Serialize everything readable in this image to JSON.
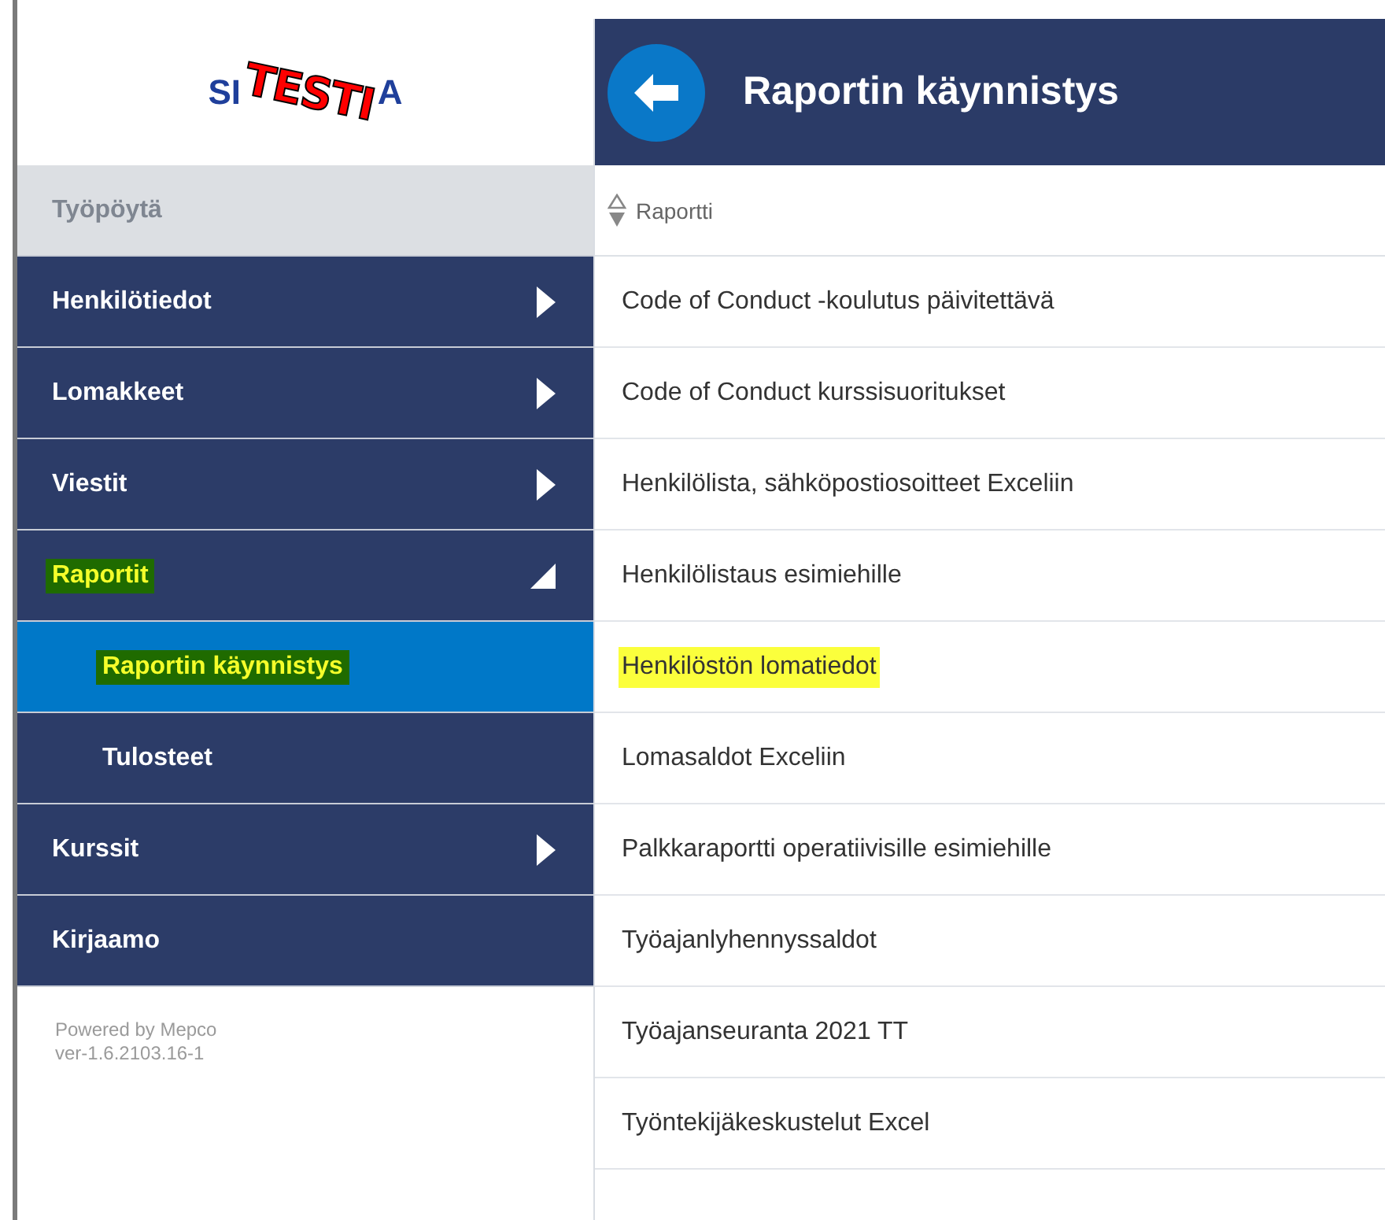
{
  "logo": {
    "brand_left": "SI",
    "brand_right": "A",
    "stamp": "TESTI"
  },
  "sidebar": {
    "items": [
      {
        "label": "Työpöytä",
        "kind": "disabled",
        "selected": false,
        "highlighted": false
      },
      {
        "label": "Henkilötiedot",
        "kind": "group",
        "expanded": false,
        "selected": false,
        "highlighted": false
      },
      {
        "label": "Lomakkeet",
        "kind": "group",
        "expanded": false,
        "selected": false,
        "highlighted": false
      },
      {
        "label": "Viestit",
        "kind": "group",
        "expanded": false,
        "selected": false,
        "highlighted": false
      },
      {
        "label": "Raportit",
        "kind": "group",
        "expanded": true,
        "selected": false,
        "highlighted": true,
        "children": [
          {
            "label": "Raportin käynnistys",
            "selected": true,
            "highlighted": true
          },
          {
            "label": "Tulosteet",
            "selected": false,
            "highlighted": false
          }
        ]
      },
      {
        "label": "Kurssit",
        "kind": "group",
        "expanded": false,
        "selected": false,
        "highlighted": false
      },
      {
        "label": "Kirjaamo",
        "kind": "link",
        "selected": false,
        "highlighted": false
      }
    ],
    "footer": [
      "Powered by Mepco",
      "ver-1.6.2103.16-1"
    ]
  },
  "header": {
    "title": "Raportin käynnistys"
  },
  "table": {
    "columns": [
      "Raportti"
    ],
    "rows": [
      {
        "cells": [
          "Code of Conduct -koulutus päivitettävä"
        ],
        "highlighted": false
      },
      {
        "cells": [
          "Code of Conduct kurssisuoritukset"
        ],
        "highlighted": false
      },
      {
        "cells": [
          "Henkilölista, sähköpostiosoitteet Exceliin"
        ],
        "highlighted": false
      },
      {
        "cells": [
          "Henkilölistaus esimiehille"
        ],
        "highlighted": false
      },
      {
        "cells": [
          "Henkilöstön lomatiedot"
        ],
        "highlighted": true
      },
      {
        "cells": [
          "Lomasaldot Exceliin"
        ],
        "highlighted": false
      },
      {
        "cells": [
          "Palkkaraportti operatiivisille esimiehille"
        ],
        "highlighted": false
      },
      {
        "cells": [
          "Työajanlyhennyssaldot"
        ],
        "highlighted": false
      },
      {
        "cells": [
          "Työajanseuranta 2021 TT"
        ],
        "highlighted": false
      },
      {
        "cells": [
          "Työntekijäkeskustelut Excel"
        ],
        "highlighted": false
      }
    ]
  }
}
